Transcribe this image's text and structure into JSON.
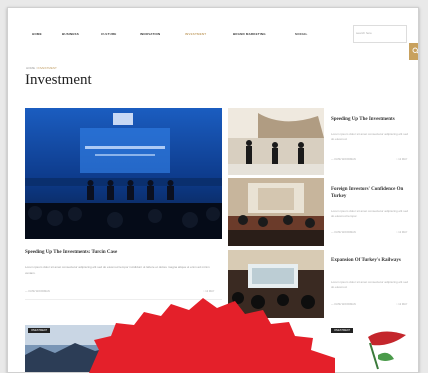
{
  "nav": {
    "items": [
      "HOME",
      "BUSINESS",
      "CULTURE",
      "INNOVATION",
      "INVESTMENT",
      "BRAND MARKETING",
      "SOCIAL"
    ],
    "active_index": 4,
    "search_placeholder": "search here"
  },
  "breadcrumb": {
    "home": "HOME",
    "current": "INVESTMENT"
  },
  "page_title": "Investment",
  "hero": {
    "title": "Speeding Up The Investments: Turcin Case",
    "description": "Lorem ipsum dolor sit amet consectetur adipiscing elit sed do eiusmod tempor incididunt ut labore et dolore magna aliqua ut enim ad minim veniam.",
    "author": "— KATE WOODMAN",
    "meta_right": "○ 12 MAY"
  },
  "side_articles": [
    {
      "title": "Speeding Up The Investments",
      "description": "Lorem ipsum dolor sit amet consectetur adipiscing elit sed do eiusmod.",
      "author": "— KATE WOODMAN",
      "date": "○ 12 MAY"
    },
    {
      "title": "Foreign Investors' Confidence On Turkey",
      "description": "Lorem ipsum dolor sit amet consectetur adipiscing elit sed do eiusmod tempor.",
      "author": "— KATE WOODMAN",
      "date": "○ 12 MAY"
    },
    {
      "title": "Expansion Of Turkey's Railways",
      "description": "Lorem ipsum dolor sit amet consectetur adipiscing elit sed do eiusmod.",
      "author": "— KATE WOODMAN",
      "date": "○ 12 MAY"
    }
  ],
  "bottom_tags": [
    "INVESTMENT",
    "INVESTMENT",
    "INVESTMENT"
  ],
  "colors": {
    "accent": "#c8a15e",
    "sticker": "#e4202a"
  }
}
